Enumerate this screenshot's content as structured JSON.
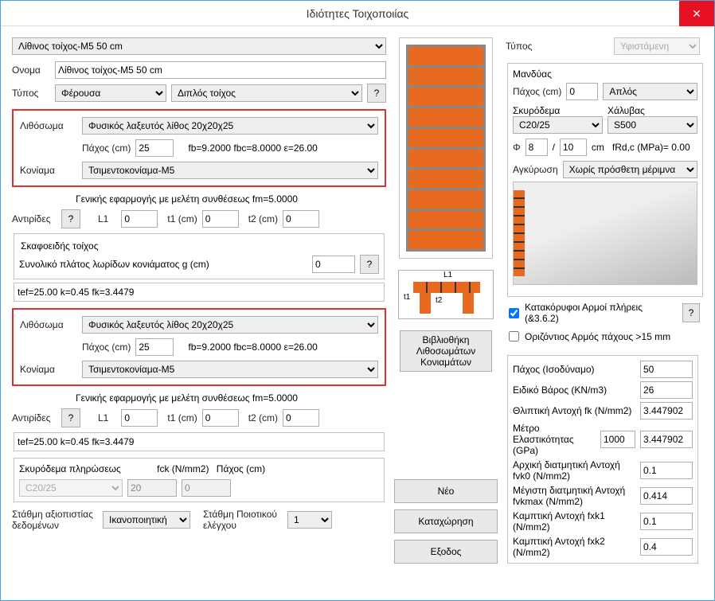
{
  "title": "Ιδιότητες Τοιχοποιίας",
  "top": {
    "preset": "Λίθινος τοίχος-M5 50 cm",
    "name_label": "Ονομα",
    "name_value": "Λίθινος τοίχος-M5 50 cm",
    "type_label": "Τύπος",
    "type_bearing": "Φέρουσα",
    "type_wall": "Διπλός τοίχος"
  },
  "section1": {
    "lithosoma_label": "Λιθόσωμα",
    "lithosoma_value": "Φυσικός λαξευτός λίθος 20χ20χ25",
    "thickness_label": "Πάχος (cm)",
    "thickness_value": "25",
    "fb_text": "fb=9.2000 fbc=8.0000 ε=26.00",
    "koniama_label": "Κονίαμα",
    "koniama_value": "Τσιμεντοκονίαμα-M5",
    "general_text": "Γενικής εφαρμογής με μελέτη συνθέσεως fm=5.0000",
    "antirides_label": "Αντιρίδες",
    "L1_label": "L1",
    "L1_value": "0",
    "t1_label": "t1 (cm)",
    "t1_value": "0",
    "t2_label": "t2 (cm)",
    "t2_value": "0",
    "skafo_title": "Σκαφοειδής τοίχος",
    "skafo_label": "Συνολικό πλάτος λωρίδων κονιάματος g (cm)",
    "skafo_value": "0",
    "tef_text": "tef=25.00 k=0.45 fk=3.4479"
  },
  "filling": {
    "label": "Σκυρόδεμα πληρώσεως",
    "concrete": "C20/25",
    "fck_label": "fck (N/mm2)",
    "fck_value": "20",
    "thickness_label": "Πάχος (cm)",
    "thickness_value": "0"
  },
  "bottom": {
    "reliability_label": "Στάθμη αξιοπιστίας δεδομένων",
    "reliability_value": "Ικανοποιητική",
    "quality_label": "Στάθμη Ποιοτικού ελέγχου",
    "quality_value": "1"
  },
  "mid": {
    "library_btn": "Βιβλιοθήκη Λιθοσωμάτων Κονιαμάτων",
    "new_btn": "Νέο",
    "save_btn": "Καταχώρηση",
    "exit_btn": "Εξοδος"
  },
  "right": {
    "type_label": "Τύπος",
    "type_value": "Υφιστάμενη",
    "jacket_label": "Μανδύας",
    "thickness_label": "Πάχος (cm)",
    "thickness_value": "0",
    "jacket_type": "Απλός",
    "concrete_label": "Σκυρόδεμα",
    "concrete_value": "C20/25",
    "steel_label": "Χάλυβας",
    "steel_value": "S500",
    "phi_label": "Φ",
    "phi_value": "8",
    "slash": "/",
    "spacing_value": "10",
    "cm_label": "cm",
    "frd_label": "fRd,c (MPa)=  0.00",
    "anchor_label": "Αγκύρωση",
    "anchor_value": "Χωρίς πρόσθετη μέριμνα",
    "chk1_label": "Κατακόρυφοι Αρμοί πλήρεις (&3.6.2)",
    "chk1_on": true,
    "chk2_label": "Οριζόντιος Αρμός πάχους >15 mm",
    "chk2_on": false,
    "vals": {
      "eq_thick_label": "Πάχος (Ισοδύναμο)",
      "eq_thick_value": "50",
      "weight_label": "Ειδικό Βάρος (KN/m3)",
      "weight_value": "26",
      "fk_label": "Θλιπτική Αντοχή fk (N/mm2)",
      "fk_value": "3.447902",
      "modulus_label": "Μέτρο Ελαστικότητας (GPa)",
      "modulus_value1": "1000",
      "modulus_value2": "3.447902",
      "fvk0_label": "Αρχική διατμητική Αντοχή fvk0 (N/mm2)",
      "fvk0_value": "0.1",
      "fvkmax_label": "Μέγιστη διατμητική Αντοχή fvkmax (N/mm2)",
      "fvkmax_value": "0.414",
      "fxk1_label": "Καμπτική Αντοχή  fxk1 (N/mm2)",
      "fxk1_value": "0.1",
      "fxk2_label": "Καμπτική Αντοχή  fxk2 (N/mm2)",
      "fxk2_value": "0.4"
    }
  }
}
